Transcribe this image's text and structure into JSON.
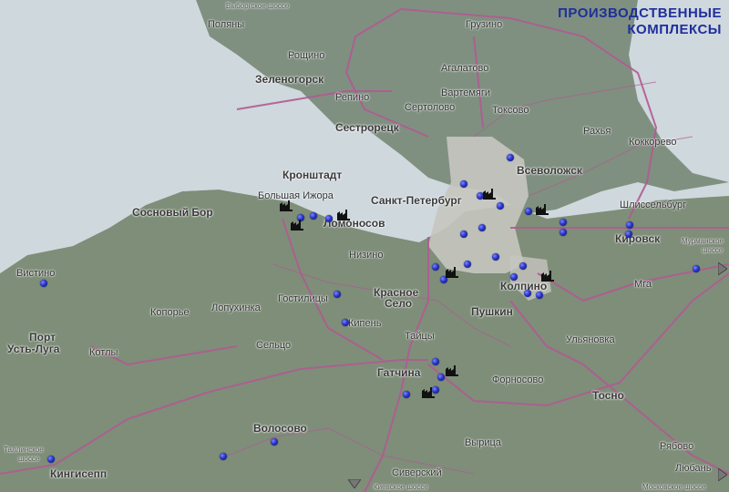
{
  "title_line1": "ПРОИЗВОДСТВЕННЫЕ",
  "title_line2": "КОМПЛЕКСЫ",
  "labels": {
    "vyborgskoe_shosse": "Выборгское шоссе",
    "polyany": "Поляны",
    "roschino": "Рощино",
    "zelenogorsk": "Зеленогорск",
    "repino": "Репино",
    "sestroretsk": "Сестрорецк",
    "sertolovo": "Сертолово",
    "agalatovo": "Агалатово",
    "vartemyagi": "Вартемяги",
    "gruzino": "Грузино",
    "toksovo": "Токсово",
    "vsevolozhsk": "Всеволожск",
    "rakhya": "Рахья",
    "kokkorevo": "Коккорево",
    "kronshtadt": "Кронштадт",
    "bolshaya_izhora": "Большая Ижора",
    "spb": "Санкт-Петербург",
    "sosnovy_bor": "Сосновый Бор",
    "lomonosov": "Ломоносов",
    "shlisselburg": "Шлиссельбург",
    "kirovsk": "Кировск",
    "murmanskoe": "Мурманское",
    "shosse": "шоссе",
    "nizino": "Низино",
    "vistino": "Вистино",
    "koporye": "Копорье",
    "lopukhinka": "Лопухинка",
    "gostilitsy": "Гостилицы",
    "krasnoe_selo_1": "Красное",
    "krasnoe_selo_2": "Село",
    "kolpino": "Колпино",
    "mga": "Мга",
    "pushkin": "Пушкин",
    "kipen": "Кипень",
    "port": "Порт",
    "ust_luga": "Усть-Луга",
    "kotly": "Котлы",
    "selco": "Сельцо",
    "taitsy": "Тайцы",
    "ulyanovka": "Ульяновка",
    "gatchina": "Гатчина",
    "fornosovo": "Форносово",
    "tosno": "Тосно",
    "volosovo": "Волосово",
    "tallinskoe": "Таллинское",
    "shosse2": "шоссе",
    "kingisepp": "Кингисепп",
    "vyritsa": "Вырица",
    "ryabovo": "Рябово",
    "siversky": "Сиверский",
    "lyuban": "Любань",
    "kievskoe": "Киевское шоссе",
    "moskovskoe": "Московское шоссе"
  },
  "colors": {
    "water": "#cfd8dd",
    "land": "#7d8c79",
    "urban": "#c9c9c3",
    "road": "#b15a92",
    "title": "#1f2f9c",
    "dot": "#2a34c7"
  },
  "icons": [
    "factory-icon"
  ]
}
